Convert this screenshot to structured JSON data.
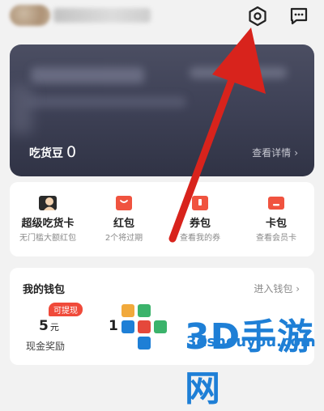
{
  "header": {
    "settings_icon": "settings-gear-icon",
    "message_icon": "message-icon"
  },
  "member_card": {
    "beans_label": "吃货豆",
    "beans_value": "0",
    "details_label": "查看详情",
    "details_chevron": "›"
  },
  "quick_menu": {
    "items": [
      {
        "label": "超级吃货卡",
        "sub": "无门槛大额红包",
        "icon": "super-card-icon"
      },
      {
        "label": "红包",
        "sub": "2个将过期",
        "icon": "red-packet-icon"
      },
      {
        "label": "券包",
        "sub": "查看我的券",
        "icon": "coupon-icon"
      },
      {
        "label": "卡包",
        "sub": "查看会员卡",
        "icon": "card-pack-icon"
      }
    ]
  },
  "wallet": {
    "title": "我的钱包",
    "enter_label": "进入钱包",
    "enter_chevron": "›",
    "cash_badge": "可提现",
    "cash_value": "5",
    "cash_unit": "元",
    "cash_label": "现金奖励",
    "second_value": "1"
  },
  "watermark": {
    "brand": "3D手游网",
    "url": "3dshouyou.com"
  },
  "colors": {
    "card_bg": "#3f4257",
    "accent_red": "#f04a3a",
    "arrow_red": "#d8231c",
    "watermark_blue": "#1e7fd6"
  }
}
